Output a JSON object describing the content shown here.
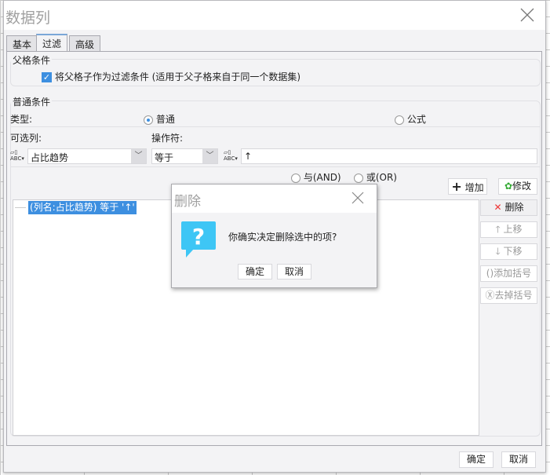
{
  "window": {
    "title": "数据列"
  },
  "tabs": [
    {
      "label": "基本"
    },
    {
      "label": "过滤"
    },
    {
      "label": "高级"
    }
  ],
  "parent_condition": {
    "group_label": "父格条件",
    "checkbox_label": "将父格子作为过滤条件 (适用于父子格来自于同一个数据集)",
    "checked": true
  },
  "normal_condition": {
    "group_label": "普通条件",
    "type_label": "类型:",
    "type_options": [
      {
        "label": "普通",
        "selected": true
      },
      {
        "label": "公式",
        "selected": false
      }
    ],
    "column_label": "可选列:",
    "column_value": "占比趋势",
    "operator_label": "操作符:",
    "operator_value": "等于",
    "value": "↑",
    "logic_options": [
      {
        "label": "与(AND)"
      },
      {
        "label": "或(OR)"
      }
    ],
    "add_button": "增加",
    "modify_button": "修改"
  },
  "conditions": [
    {
      "text": "(列名:占比趋势) 等于 '↑'",
      "selected": true
    }
  ],
  "side_buttons": {
    "delete": "删除",
    "move_up": "上移",
    "move_down": "下移",
    "add_bracket": "添加括号",
    "remove_bracket": "去掉括号"
  },
  "footer": {
    "ok": "确定",
    "cancel": "取消"
  },
  "modal": {
    "title": "删除",
    "message": "你确实决定删除选中的项?",
    "ok": "确定",
    "cancel": "取消",
    "icon_color": "#3ec6f5"
  }
}
